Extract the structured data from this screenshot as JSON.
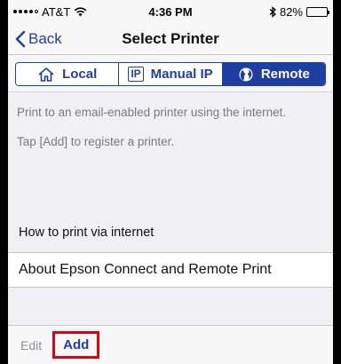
{
  "status_bar": {
    "carrier": "AT&T",
    "time": "4:36 PM",
    "battery_percent": "82%",
    "battery_level": 0.82
  },
  "nav": {
    "back_label": "Back",
    "title": "Select Printer"
  },
  "segments": [
    {
      "label": "Local",
      "icon": "home-icon",
      "active": false
    },
    {
      "label": "Manual IP",
      "icon": "ip-icon",
      "icon_text": "IP",
      "active": false
    },
    {
      "label": "Remote",
      "icon": "globe-icon",
      "active": true
    }
  ],
  "info": {
    "line1": "Print to an email-enabled printer using the internet.",
    "line2": "Tap [Add] to register a printer."
  },
  "section": {
    "header": "How to print via internet",
    "item": "About Epson Connect and Remote Print"
  },
  "toolbar": {
    "edit_label": "Edit",
    "add_label": "Add"
  },
  "colors": {
    "accent": "#1e3fa0",
    "highlight": "#e00010"
  }
}
